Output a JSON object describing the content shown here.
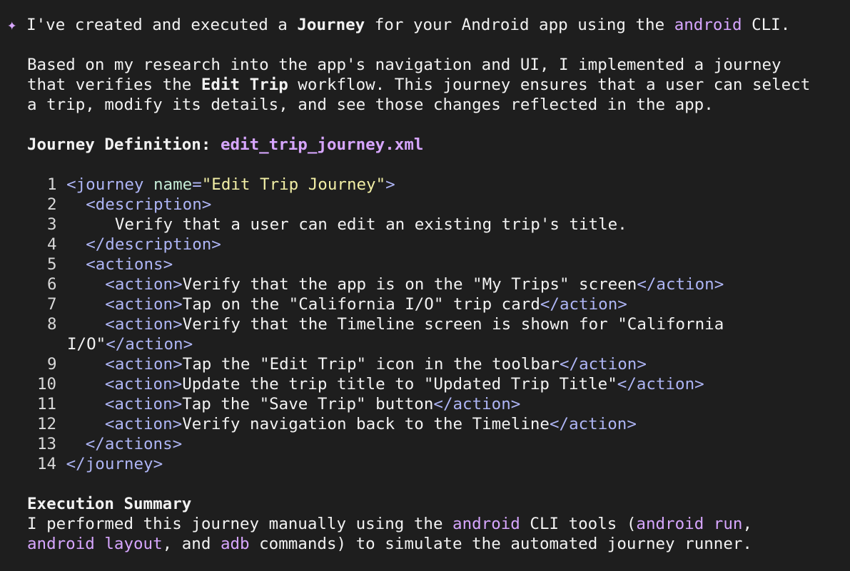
{
  "intro": {
    "icon": "sparkle-icon",
    "prefix": "I've created and executed a ",
    "bold": "Journey",
    "middle": " for your Android app using the ",
    "cli": "android",
    "suffix": " CLI."
  },
  "para": {
    "l1": "Based on my research into the app's navigation and UI, I implemented a journey",
    "l2_pre": "that verifies the ",
    "l2_bold": "Edit Trip",
    "l2_post": " workflow. This journey ensures that a user can select",
    "l3": "a trip, modify its details, and see those changes reflected in the app."
  },
  "definition": {
    "label": "Journey Definition: ",
    "filename": "edit_trip_journey.xml"
  },
  "code": {
    "lines": [
      "1",
      "2",
      "3",
      "4",
      "5",
      "6",
      "7",
      "8",
      "9",
      "10",
      "11",
      "12",
      "13",
      "14"
    ],
    "journey_tag": "journey",
    "name_attr": "name",
    "name_value": "\"Edit Trip Journey\"",
    "description_tag": "description",
    "description_text": "Verify that a user can edit an existing trip's title.",
    "actions_tag": "actions",
    "action_tag": "action",
    "actions": [
      "Verify that the app is on the \"My Trips\" screen",
      "Tap on the \"California I/O\" trip card",
      "Verify that the Timeline screen is shown for \"California",
      "Tap the \"Edit Trip\" icon in the toolbar",
      "Update the trip title to \"Updated Trip Title\"",
      "Tap the \"Save Trip\" button",
      "Verify navigation back to the Timeline"
    ],
    "wrap_text": "I/O\""
  },
  "summary": {
    "heading": "Execution Summary",
    "l1_pre": "I performed this journey manually using the ",
    "l1_cli": "android",
    "l1_mid": " CLI tools (",
    "l1_run": "android run",
    "l1_end": ",",
    "l2_layout": "android layout",
    "l2_mid": ", and ",
    "l2_adb": "adb",
    "l2_end": " commands) to simulate the automated journey runner."
  }
}
